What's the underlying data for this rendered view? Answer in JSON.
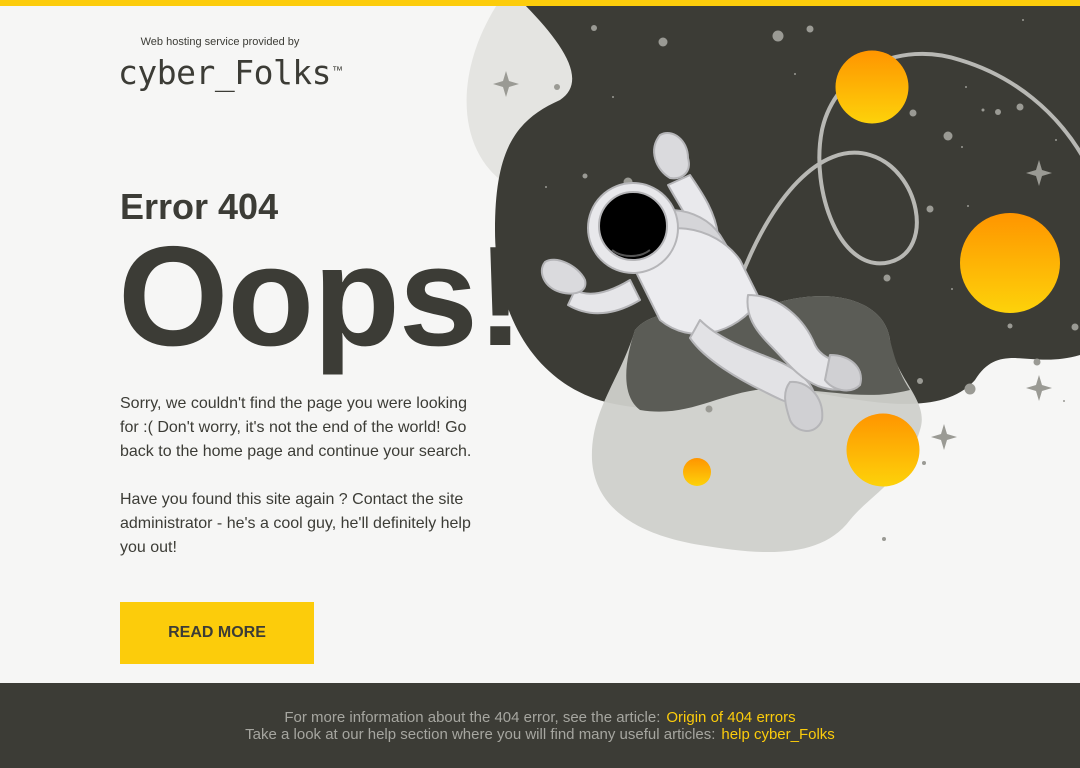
{
  "header": {
    "provider_text": "Web hosting service provided by",
    "logo_text": "cyber_Folks",
    "logo_tm": "™"
  },
  "main": {
    "error_code": "Error 404",
    "headline": "Oops!",
    "paragraph1": "Sorry, we couldn't find the page you were looking for :( Don't worry, it's not the end of the world! Go back to the home page and continue your search.",
    "paragraph2": "Have you found this site again ? Contact the site administrator - he's a cool guy, he'll definitely help you out!",
    "button_label": "READ MORE"
  },
  "footer": {
    "line1_text": "For more information about the 404 error, see the article:",
    "line1_link": "Origin of 404 errors",
    "line2_text": "Take a look at our help section where you will find many useful articles:",
    "line2_link": "help cyber_Folks"
  },
  "colors": {
    "accent": "#fccc0b",
    "dark": "#3c3c36",
    "background": "#f6f6f5",
    "footer_text": "#a6a6a0"
  }
}
